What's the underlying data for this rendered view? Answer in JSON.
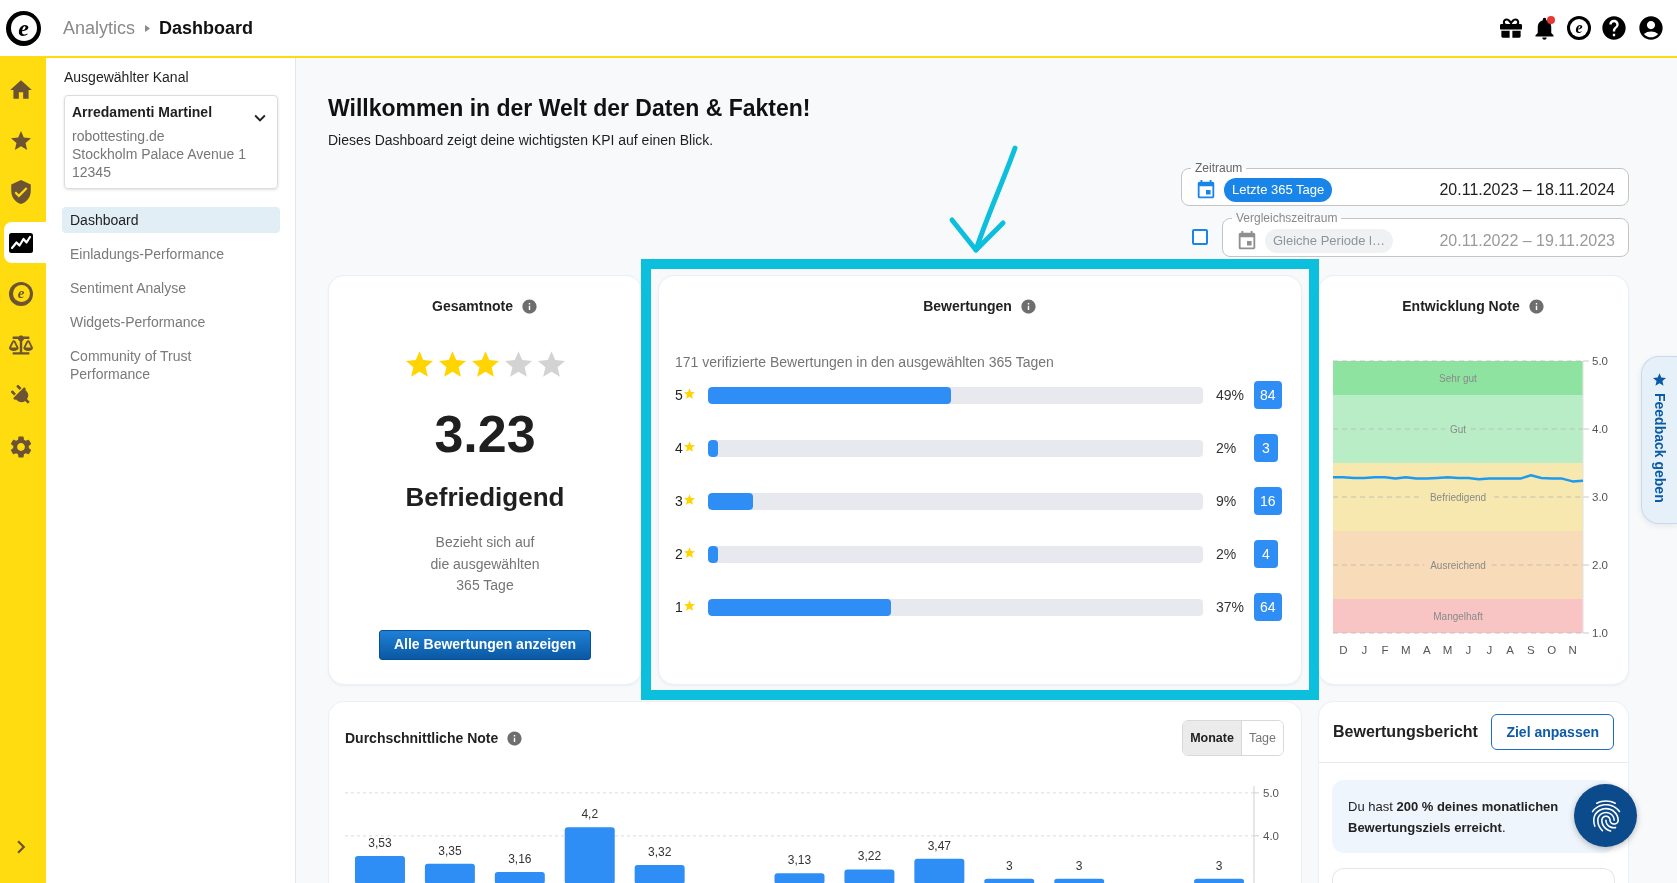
{
  "header": {
    "logo": "e",
    "breadcrumb": {
      "parent": "Analytics",
      "current": "Dashboard"
    },
    "icons": [
      {
        "kind": "gift"
      },
      {
        "kind": "bell",
        "badge": true
      },
      {
        "kind": "brand",
        "glyph": "e"
      },
      {
        "kind": "help"
      },
      {
        "kind": "account"
      }
    ]
  },
  "rail": [
    {
      "kind": "home",
      "selected": false
    },
    {
      "kind": "star",
      "selected": false
    },
    {
      "kind": "shield",
      "selected": false
    },
    {
      "kind": "chart",
      "selected": true
    },
    {
      "kind": "brand",
      "glyph": "e",
      "selected": false
    },
    {
      "kind": "scale",
      "selected": false
    },
    {
      "kind": "plug",
      "selected": false
    },
    {
      "kind": "settings",
      "selected": false
    }
  ],
  "sidebar": {
    "channel_label": "Ausgewählter Kanal",
    "channel": {
      "name": "Arredamenti Martinel",
      "details": [
        "robottesting.de",
        "Stockholm Palace Avenue 1",
        "12345"
      ]
    },
    "nav": [
      {
        "label": "Dashboard",
        "selected": true
      },
      {
        "label": "Einladungs-Performance",
        "selected": false
      },
      {
        "label": "Sentiment Analyse",
        "selected": false
      },
      {
        "label": "Widgets-Performance",
        "selected": false
      },
      {
        "label": "Community of Trust Performance",
        "selected": false
      }
    ]
  },
  "page": {
    "title": "Willkommen in der Welt der Daten & Fakten!",
    "subtitle": "Dieses Dashboard zeigt deine wichtigsten KPI auf einen Blick."
  },
  "period": {
    "label": "Zeitraum",
    "chip": "Letzte 365 Tage",
    "range": "20.11.2023 – 18.11.2024"
  },
  "comparison": {
    "checked": false,
    "disabled": true,
    "label": "Vergleichszeitraum",
    "chip": "Gleiche Periode l…",
    "range": "20.11.2022 – 19.11.2023"
  },
  "overall_card": {
    "title": "Gesamtnote",
    "stars": 3,
    "score": "3.23",
    "grade": "Befriedigend",
    "note": "Bezieht sich auf die ausgewählten 365 Tage",
    "button": "Alle Bewertungen anzeigen"
  },
  "reviews_card": {
    "title": "Bewertungen",
    "highlighted": true,
    "summary": "171 verifizierte Bewertungen in den ausgewählten 365 Tagen",
    "rows": [
      {
        "rating": "5",
        "level": 0.49,
        "percent": "49%",
        "count": "84"
      },
      {
        "rating": "4",
        "level": 0.02,
        "percent": "2%",
        "count": "3"
      },
      {
        "rating": "3",
        "level": 0.09,
        "percent": "9%",
        "count": "16"
      },
      {
        "rating": "2",
        "level": 0.02,
        "percent": "2%",
        "count": "4"
      },
      {
        "rating": "1",
        "level": 0.37,
        "percent": "37%",
        "count": "64"
      }
    ]
  },
  "trend_card": {
    "title": "Entwicklung Note",
    "chart_data": {
      "type": "line",
      "grid": true,
      "categories": [
        null,
        "D",
        null,
        "J",
        null,
        "F",
        null,
        "M",
        null,
        "A",
        null,
        "M",
        null,
        "J",
        null,
        "J",
        null,
        "A",
        null,
        "S",
        null,
        "O",
        null,
        "N",
        null
      ],
      "ylim": [
        1,
        5
      ],
      "yticks": [
        {
          "value": 1,
          "label": "1.0"
        },
        {
          "value": 2,
          "label": "2.0"
        },
        {
          "value": 3,
          "label": "3.0"
        },
        {
          "value": 4,
          "label": "4.0"
        },
        {
          "value": 5,
          "label": "5.0"
        }
      ],
      "series": [
        {
          "color": "#1e9bf0",
          "values": [
            3.29,
            3.29,
            3.28,
            3.28,
            3.29,
            3.29,
            3.27,
            3.29,
            3.27,
            3.27,
            3.28,
            3.29,
            3.28,
            3.28,
            3.26,
            3.27,
            3.27,
            3.27,
            3.27,
            3.32,
            3.28,
            3.27,
            3.27,
            3.23,
            3.24
          ]
        }
      ],
      "bands": [
        {
          "axis": "y",
          "label": "Sehr gut",
          "from": 4.5,
          "to": 5,
          "color": "#8fe3a0"
        },
        {
          "axis": "y",
          "label": "Gut",
          "from": 3.5,
          "to": 4.5,
          "color": "#b9edc5"
        },
        {
          "axis": "y",
          "label": "Befriedigend",
          "from": 2.5,
          "to": 3.5,
          "color": "#f6e8ae"
        },
        {
          "axis": "y",
          "label": "Ausreichend",
          "from": 1.5,
          "to": 2.5,
          "color": "#f8dbb8"
        },
        {
          "axis": "y",
          "label": "Mangelhaft",
          "from": 1,
          "to": 1.5,
          "color": "#f8c4c4"
        }
      ]
    }
  },
  "average_card": {
    "title": "Durchschnittliche Note",
    "toggle": [
      {
        "label": "Monate",
        "selected": true
      },
      {
        "label": "Tage",
        "selected": false
      }
    ],
    "chart_data": {
      "type": "bar",
      "grid": true,
      "values": [
        3.53,
        3.35,
        3.16,
        4.2,
        3.32,
        null,
        3.13,
        3.22,
        3.47,
        3,
        3,
        null,
        3
      ],
      "value_labels": [
        "3,53",
        "3,35",
        "3,16",
        "4,2",
        "3,32",
        null,
        "3,13",
        "3,22",
        "3,47",
        "3",
        "3",
        null,
        "3"
      ],
      "ylim": [
        2.88,
        5.16
      ],
      "yticks": [
        {
          "value": 4,
          "label": "4.0"
        },
        {
          "value": 5,
          "label": "5.0"
        }
      ]
    }
  },
  "report_card": {
    "title": "Bewertungsbericht",
    "button": "Ziel anpassen",
    "message": "Du hast **200 % deines monatlichen Bewertungsziels erreicht**."
  },
  "feedback_tab": {
    "label": "Feedback geben"
  }
}
